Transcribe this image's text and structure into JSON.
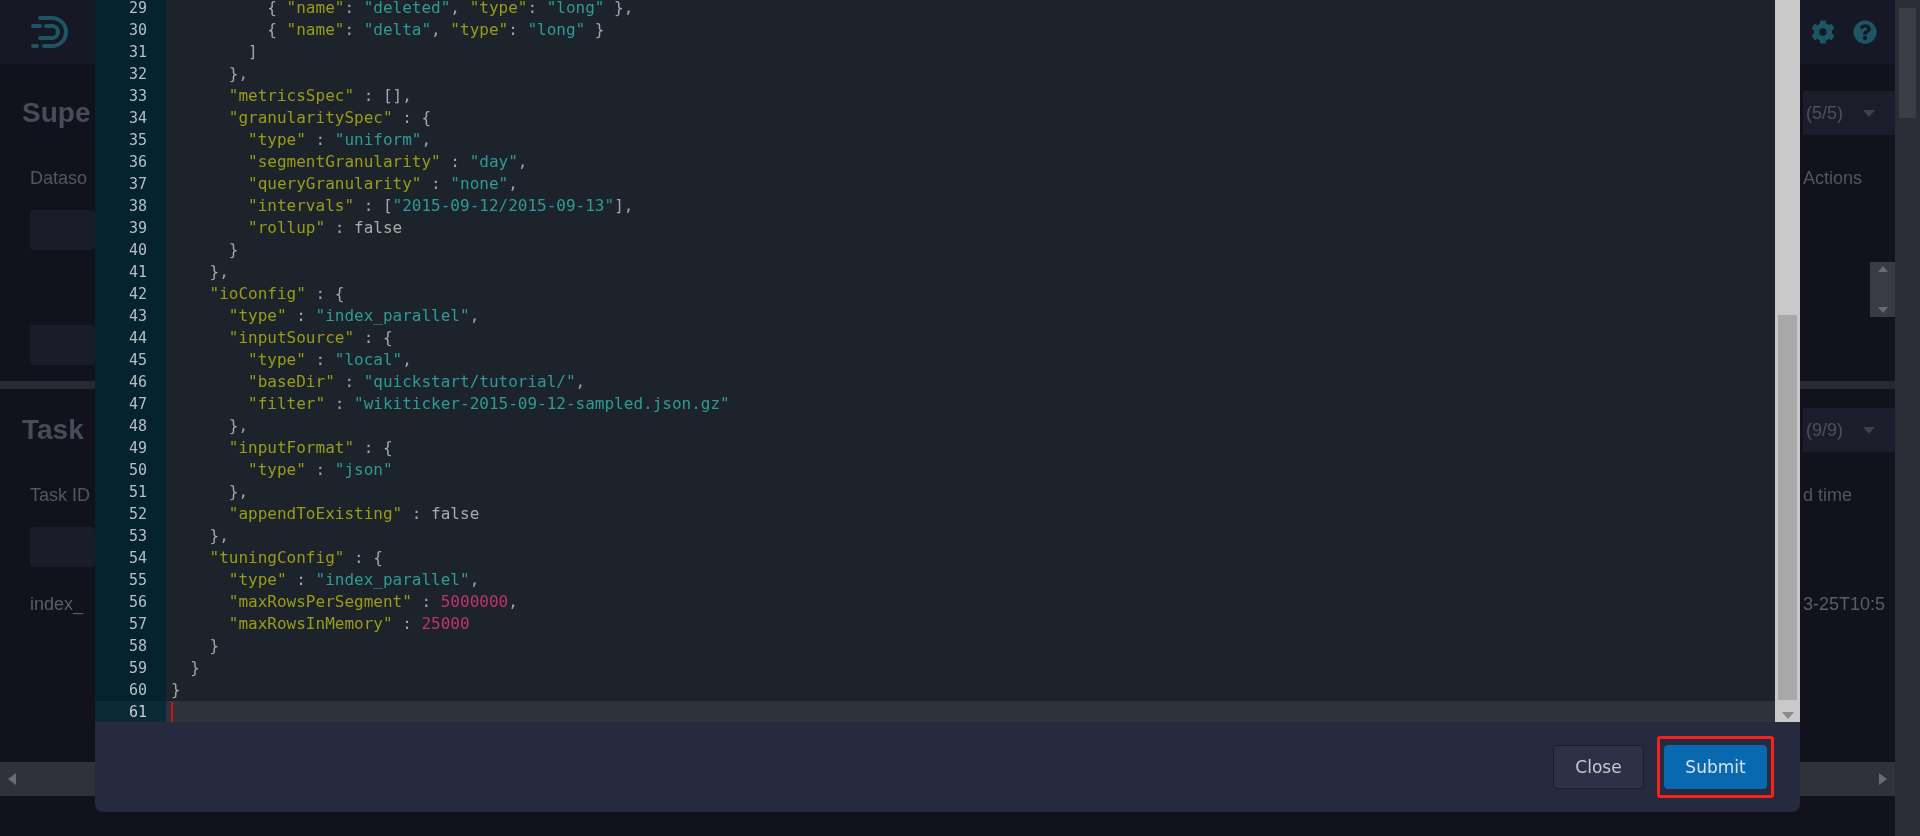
{
  "page_behind": {
    "sections": [
      {
        "title": "Supe",
        "filter_count": "(5/5)",
        "first_column": "Dataso",
        "last_column": "Actions"
      },
      {
        "title": "Task",
        "filter_count": "(9/9)",
        "first_column": "Task ID",
        "last_column": "d time",
        "row": {
          "first_cell": "index_",
          "last_cell": "3-25T10:5"
        }
      }
    ]
  },
  "editor": {
    "lines": [
      {
        "number": "29",
        "current": false,
        "tokens": [
          {
            "kind": "punct",
            "text": "          { "
          },
          {
            "kind": "key",
            "text": "\"name\""
          },
          {
            "kind": "punct",
            "text": ": "
          },
          {
            "kind": "string",
            "text": "\"deleted\""
          },
          {
            "kind": "punct",
            "text": ", "
          },
          {
            "kind": "key",
            "text": "\"type\""
          },
          {
            "kind": "punct",
            "text": ": "
          },
          {
            "kind": "string",
            "text": "\"long\""
          },
          {
            "kind": "punct",
            "text": " },"
          }
        ]
      },
      {
        "number": "30",
        "current": false,
        "tokens": [
          {
            "kind": "punct",
            "text": "          { "
          },
          {
            "kind": "key",
            "text": "\"name\""
          },
          {
            "kind": "punct",
            "text": ": "
          },
          {
            "kind": "string",
            "text": "\"delta\""
          },
          {
            "kind": "punct",
            "text": ", "
          },
          {
            "kind": "key",
            "text": "\"type\""
          },
          {
            "kind": "punct",
            "text": ": "
          },
          {
            "kind": "string",
            "text": "\"long\""
          },
          {
            "kind": "punct",
            "text": " }"
          }
        ]
      },
      {
        "number": "31",
        "current": false,
        "tokens": [
          {
            "kind": "punct",
            "text": "        ]"
          }
        ]
      },
      {
        "number": "32",
        "current": false,
        "tokens": [
          {
            "kind": "punct",
            "text": "      },"
          }
        ]
      },
      {
        "number": "33",
        "current": false,
        "tokens": [
          {
            "kind": "key",
            "text": "      \"metricsSpec\""
          },
          {
            "kind": "punct",
            "text": " : [],"
          }
        ]
      },
      {
        "number": "34",
        "current": false,
        "tokens": [
          {
            "kind": "key",
            "text": "      \"granularitySpec\""
          },
          {
            "kind": "punct",
            "text": " : {"
          }
        ]
      },
      {
        "number": "35",
        "current": false,
        "tokens": [
          {
            "kind": "key",
            "text": "        \"type\""
          },
          {
            "kind": "punct",
            "text": " : "
          },
          {
            "kind": "string",
            "text": "\"uniform\""
          },
          {
            "kind": "punct",
            "text": ","
          }
        ]
      },
      {
        "number": "36",
        "current": false,
        "tokens": [
          {
            "kind": "key",
            "text": "        \"segmentGranularity\""
          },
          {
            "kind": "punct",
            "text": " : "
          },
          {
            "kind": "string",
            "text": "\"day\""
          },
          {
            "kind": "punct",
            "text": ","
          }
        ]
      },
      {
        "number": "37",
        "current": false,
        "tokens": [
          {
            "kind": "key",
            "text": "        \"queryGranularity\""
          },
          {
            "kind": "punct",
            "text": " : "
          },
          {
            "kind": "string",
            "text": "\"none\""
          },
          {
            "kind": "punct",
            "text": ","
          }
        ]
      },
      {
        "number": "38",
        "current": false,
        "tokens": [
          {
            "kind": "key",
            "text": "        \"intervals\""
          },
          {
            "kind": "punct",
            "text": " : ["
          },
          {
            "kind": "string",
            "text": "\"2015-09-12/2015-09-13\""
          },
          {
            "kind": "punct",
            "text": "],"
          }
        ]
      },
      {
        "number": "39",
        "current": false,
        "tokens": [
          {
            "kind": "key",
            "text": "        \"rollup\""
          },
          {
            "kind": "punct",
            "text": " : "
          },
          {
            "kind": "literal",
            "text": "false"
          }
        ]
      },
      {
        "number": "40",
        "current": false,
        "tokens": [
          {
            "kind": "punct",
            "text": "      }"
          }
        ]
      },
      {
        "number": "41",
        "current": false,
        "tokens": [
          {
            "kind": "punct",
            "text": "    },"
          }
        ]
      },
      {
        "number": "42",
        "current": false,
        "tokens": [
          {
            "kind": "key",
            "text": "    \"ioConfig\""
          },
          {
            "kind": "punct",
            "text": " : {"
          }
        ]
      },
      {
        "number": "43",
        "current": false,
        "tokens": [
          {
            "kind": "key",
            "text": "      \"type\""
          },
          {
            "kind": "punct",
            "text": " : "
          },
          {
            "kind": "string",
            "text": "\"index_parallel\""
          },
          {
            "kind": "punct",
            "text": ","
          }
        ]
      },
      {
        "number": "44",
        "current": false,
        "tokens": [
          {
            "kind": "key",
            "text": "      \"inputSource\""
          },
          {
            "kind": "punct",
            "text": " : {"
          }
        ]
      },
      {
        "number": "45",
        "current": false,
        "tokens": [
          {
            "kind": "key",
            "text": "        \"type\""
          },
          {
            "kind": "punct",
            "text": " : "
          },
          {
            "kind": "string",
            "text": "\"local\""
          },
          {
            "kind": "punct",
            "text": ","
          }
        ]
      },
      {
        "number": "46",
        "current": false,
        "tokens": [
          {
            "kind": "key",
            "text": "        \"baseDir\""
          },
          {
            "kind": "punct",
            "text": " : "
          },
          {
            "kind": "string",
            "text": "\"quickstart/tutorial/\""
          },
          {
            "kind": "punct",
            "text": ","
          }
        ]
      },
      {
        "number": "47",
        "current": false,
        "tokens": [
          {
            "kind": "key",
            "text": "        \"filter\""
          },
          {
            "kind": "punct",
            "text": " : "
          },
          {
            "kind": "string",
            "text": "\"wikiticker-2015-09-12-sampled.json.gz\""
          }
        ]
      },
      {
        "number": "48",
        "current": false,
        "tokens": [
          {
            "kind": "punct",
            "text": "      },"
          }
        ]
      },
      {
        "number": "49",
        "current": false,
        "tokens": [
          {
            "kind": "key",
            "text": "      \"inputFormat\""
          },
          {
            "kind": "punct",
            "text": " : {"
          }
        ]
      },
      {
        "number": "50",
        "current": false,
        "tokens": [
          {
            "kind": "key",
            "text": "        \"type\""
          },
          {
            "kind": "punct",
            "text": " : "
          },
          {
            "kind": "string",
            "text": "\"json\""
          }
        ]
      },
      {
        "number": "51",
        "current": false,
        "tokens": [
          {
            "kind": "punct",
            "text": "      },"
          }
        ]
      },
      {
        "number": "52",
        "current": false,
        "tokens": [
          {
            "kind": "key",
            "text": "      \"appendToExisting\""
          },
          {
            "kind": "punct",
            "text": " : "
          },
          {
            "kind": "literal",
            "text": "false"
          }
        ]
      },
      {
        "number": "53",
        "current": false,
        "tokens": [
          {
            "kind": "punct",
            "text": "    },"
          }
        ]
      },
      {
        "number": "54",
        "current": false,
        "tokens": [
          {
            "kind": "key",
            "text": "    \"tuningConfig\""
          },
          {
            "kind": "punct",
            "text": " : {"
          }
        ]
      },
      {
        "number": "55",
        "current": false,
        "tokens": [
          {
            "kind": "key",
            "text": "      \"type\""
          },
          {
            "kind": "punct",
            "text": " : "
          },
          {
            "kind": "string",
            "text": "\"index_parallel\""
          },
          {
            "kind": "punct",
            "text": ","
          }
        ]
      },
      {
        "number": "56",
        "current": false,
        "tokens": [
          {
            "kind": "key",
            "text": "      \"maxRowsPerSegment\""
          },
          {
            "kind": "punct",
            "text": " : "
          },
          {
            "kind": "number",
            "text": "5000000"
          },
          {
            "kind": "punct",
            "text": ","
          }
        ]
      },
      {
        "number": "57",
        "current": false,
        "tokens": [
          {
            "kind": "key",
            "text": "      \"maxRowsInMemory\""
          },
          {
            "kind": "punct",
            "text": " : "
          },
          {
            "kind": "number",
            "text": "25000"
          }
        ]
      },
      {
        "number": "58",
        "current": false,
        "tokens": [
          {
            "kind": "punct",
            "text": "    }"
          }
        ]
      },
      {
        "number": "59",
        "current": false,
        "tokens": [
          {
            "kind": "punct",
            "text": "  }"
          }
        ]
      },
      {
        "number": "60",
        "current": false,
        "tokens": [
          {
            "kind": "punct",
            "text": "}"
          }
        ]
      },
      {
        "number": "61",
        "current": true
      }
    ]
  },
  "footer": {
    "buttons": [
      {
        "label": "Close",
        "kind": "secondary",
        "highlighted": false
      },
      {
        "label": "Submit",
        "kind": "primary",
        "highlighted": true
      }
    ]
  }
}
